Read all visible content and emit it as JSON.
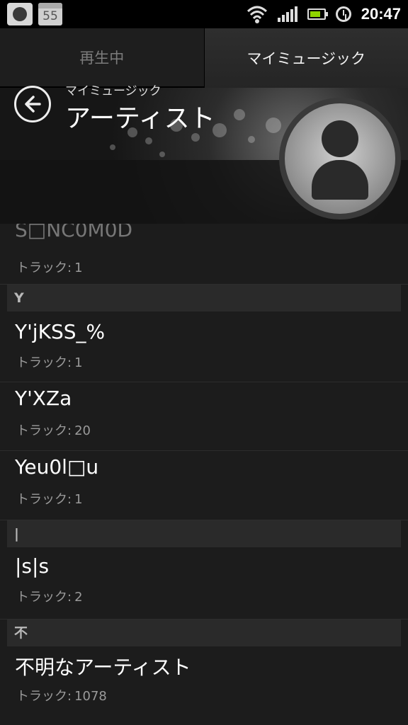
{
  "status_bar": {
    "calendar_day": "55",
    "time": "20:47",
    "icons": [
      "app-notification-icon",
      "calendar-icon",
      "wifi-icon",
      "signal-icon",
      "battery-icon",
      "alarm-icon"
    ]
  },
  "tabs": [
    {
      "label": "再生中",
      "active": false
    },
    {
      "label": "マイミュージック",
      "active": true
    }
  ],
  "header": {
    "breadcrumb": "マイミュージック",
    "title": "アーティスト"
  },
  "track_label": "トラック:",
  "list": {
    "partial_item": {
      "name": "S□NC0M0D",
      "tracks": "1"
    },
    "sections": [
      {
        "header": "Y",
        "items": [
          {
            "name": "Y'jKSS_%",
            "tracks": "1"
          },
          {
            "name": "Y'XZa",
            "tracks": "20"
          },
          {
            "name": "Yeu0l□u",
            "tracks": "1"
          }
        ]
      },
      {
        "header": "|",
        "items": [
          {
            "name": "|s|s",
            "tracks": "2"
          }
        ]
      },
      {
        "header": "不",
        "items": [
          {
            "name": "不明なアーティスト",
            "tracks": "1078"
          }
        ]
      }
    ]
  }
}
